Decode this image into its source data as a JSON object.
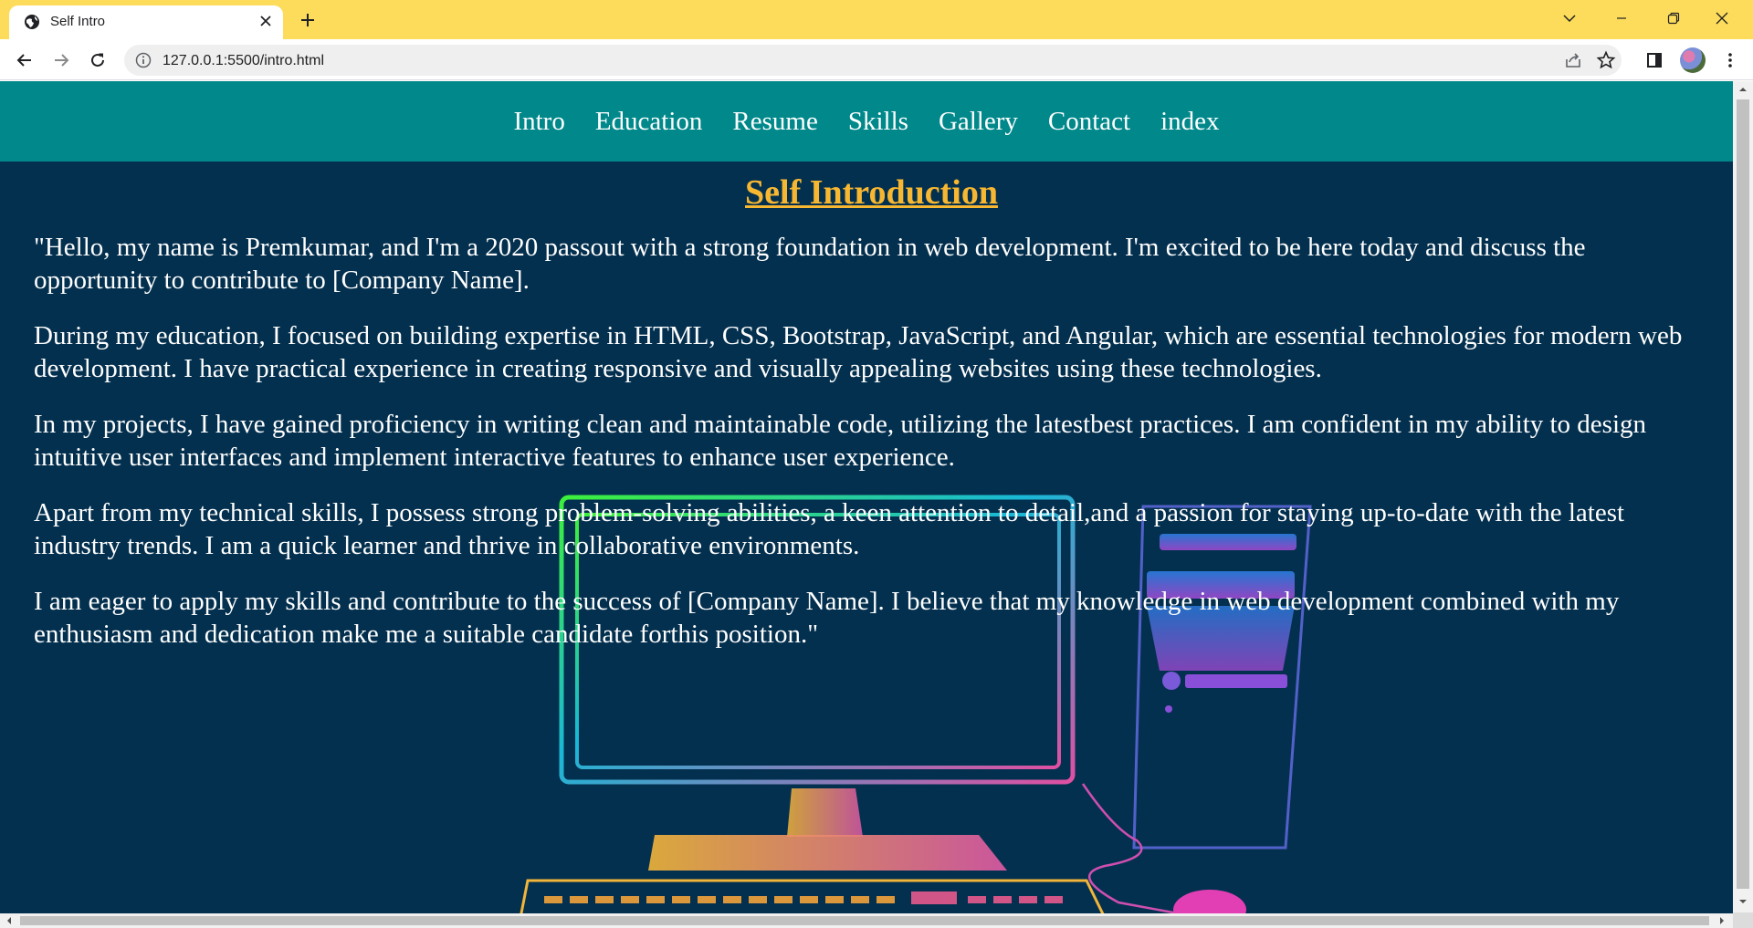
{
  "browser": {
    "tab_title": "Self Intro",
    "url": "127.0.0.1:5500/intro.html"
  },
  "nav": {
    "links": [
      "Intro",
      "Education",
      "Resume",
      "Skills",
      "Gallery",
      "Contact",
      "index"
    ]
  },
  "page": {
    "heading": "Self Introduction",
    "paragraphs": [
      "\"Hello, my name is Premkumar, and I'm a 2020 passout with a strong foundation in web development. I'm excited to be here today and discuss the opportunity to contribute to [Company Name].",
      "During my education, I focused on building expertise in HTML, CSS, Bootstrap, JavaScript, and Angular, which are essential technologies for modern web development. I have practical experience in creating responsive and visually appealing websites using these technologies.",
      "In my projects, I have gained proficiency in writing clean and maintainable code, utilizing the latestbest practices. I am confident in my ability to design intuitive user interfaces and implement interactive features to enhance user experience.",
      "Apart from my technical skills, I possess strong problem-solving abilities, a keen attention to detail,and a passion for staying up-to-date with the latest industry trends. I am a quick learner and thrive in collaborative environments.",
      "I am eager to apply my skills and contribute to the success of [Company Name]. I believe that my knowledge in web development combined with my enthusiasm and dedication make me a suitable candidate forthis position.\""
    ]
  },
  "colors": {
    "tab_strip": "#fcdc5a",
    "navbar": "#00888b",
    "page_background": "#04304f",
    "heading": "#f7b731",
    "text": "#ffffff"
  },
  "icons": [
    "globe-icon",
    "close-icon",
    "plus-icon",
    "chevron-down-icon",
    "minimize-icon",
    "restore-icon",
    "window-close-icon",
    "back-arrow-icon",
    "forward-arrow-icon",
    "reload-icon",
    "info-icon",
    "share-icon",
    "star-icon",
    "side-panel-icon",
    "kebab-menu-icon"
  ]
}
